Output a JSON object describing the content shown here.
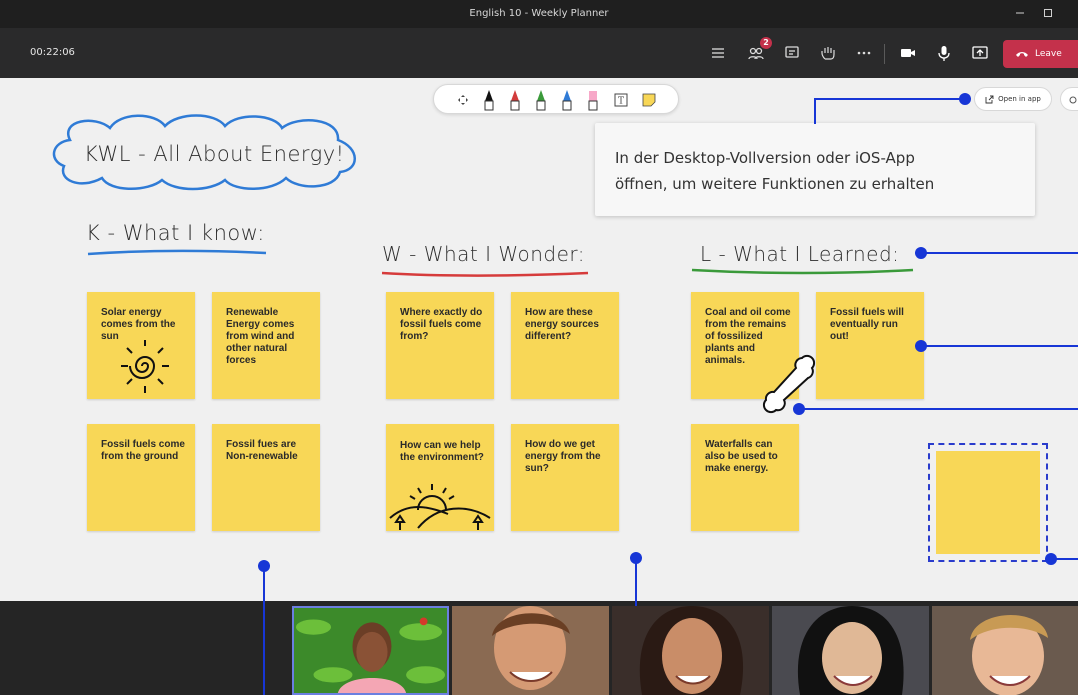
{
  "window": {
    "title": "English 10 - Weekly Planner",
    "minimize_icon": "minimize-icon",
    "maximize_icon": "maximize-icon"
  },
  "meeting": {
    "timer": "00:22:06",
    "participants_badge": "2",
    "leave_label": "Leave",
    "leave_color": "#c4314b"
  },
  "board": {
    "open_in_app_label": "Open in app",
    "tooltip": {
      "line1": "In der Desktop-Vollversion oder iOS-App",
      "line2": "öffnen, um weitere Funktionen zu erhalten"
    },
    "cloud_title": "KWL - All About Energy!",
    "headings": {
      "k": "K - What I know:",
      "w": "W - What I Wonder:",
      "l": "L - What I Learned:"
    },
    "heading_colors": {
      "k": "#2f7bd6",
      "w": "#d63b3b",
      "l": "#3a9a3a"
    },
    "notes": {
      "k1": "Solar energy comes from the sun",
      "k2": "Renewable Energy comes from wind and other natural forces",
      "k3": "Fossil fuels come from the ground",
      "k4": "Fossil fues are Non-renewable",
      "w1": "Where exactly do fossil fuels come from?",
      "w2": "How are these energy sources different?",
      "w3": "How can we help the environment?",
      "w4": "How do we get energy from the sun?",
      "l1": "Coal and oil come from the remains of fossilized plants and animals.",
      "l2": "Fossil fuels will eventually run out!",
      "l3": "Waterfalls can also be used to make energy."
    },
    "note_color": "#f8d757",
    "callout_color": "#1736d6"
  }
}
